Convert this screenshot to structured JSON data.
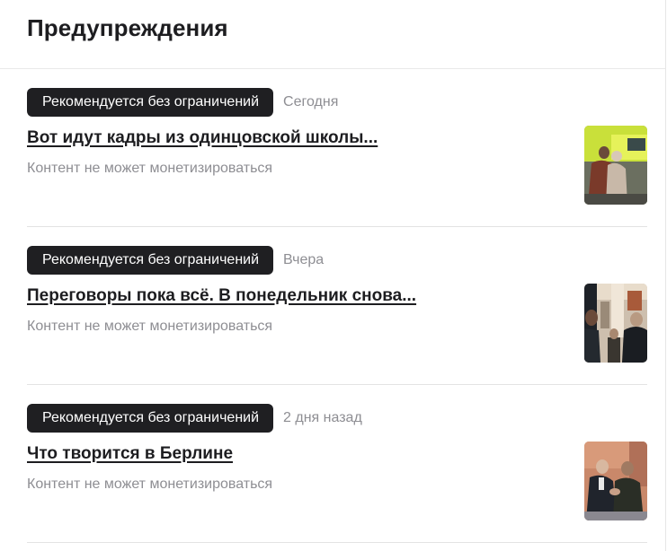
{
  "header": {
    "title": "Предупреждения"
  },
  "items": [
    {
      "badge": "Рекомендуется без ограничений",
      "date": "Сегодня",
      "title": "Вот идут кадры из одинцовской школы...",
      "subtitle": "Контент не может монетизироваться",
      "thumbnail": "school-ambulance-photo"
    },
    {
      "badge": "Рекомендуется без ограничений",
      "date": "Вчера",
      "title": "Переговоры пока всё. В понедельник снова...",
      "subtitle": "Контент не может монетизироваться",
      "thumbnail": "negotiations-photo"
    },
    {
      "badge": "Рекомендуется без ограничений",
      "date": "2 дня назад",
      "title": "Что творится в Берлине",
      "subtitle": "Контент не может монетизироваться",
      "thumbnail": "berlin-handshake-photo"
    }
  ],
  "colors": {
    "badge_bg": "#1f1f22",
    "title": "#1d1d20",
    "muted": "#8e8e93",
    "divider": "#e3e3e3"
  }
}
